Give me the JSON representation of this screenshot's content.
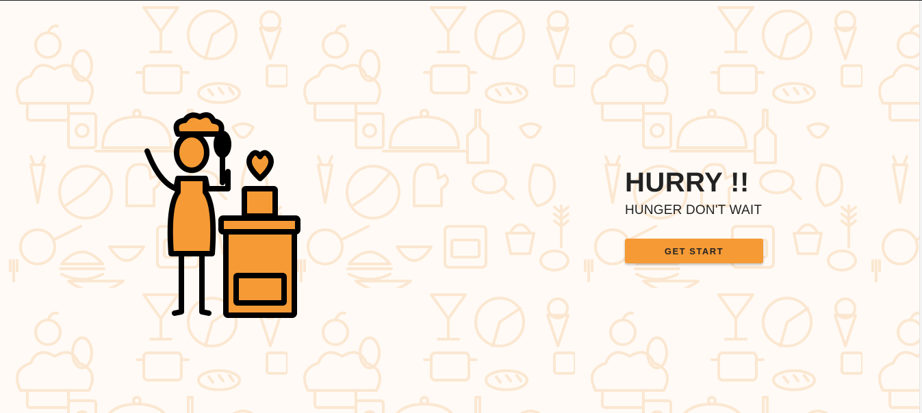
{
  "hero": {
    "title": "HURRY !!",
    "subtitle": "HUNGER DON'T WAIT",
    "cta_label": "GET START"
  },
  "illustration": {
    "icon": "chef-cooking-icon"
  },
  "background": {
    "pattern": "food-doodle-pattern"
  },
  "colors": {
    "accent": "#f59a35",
    "pattern": "#fbe3c8",
    "background": "#fffaf5",
    "text": "#222222"
  }
}
